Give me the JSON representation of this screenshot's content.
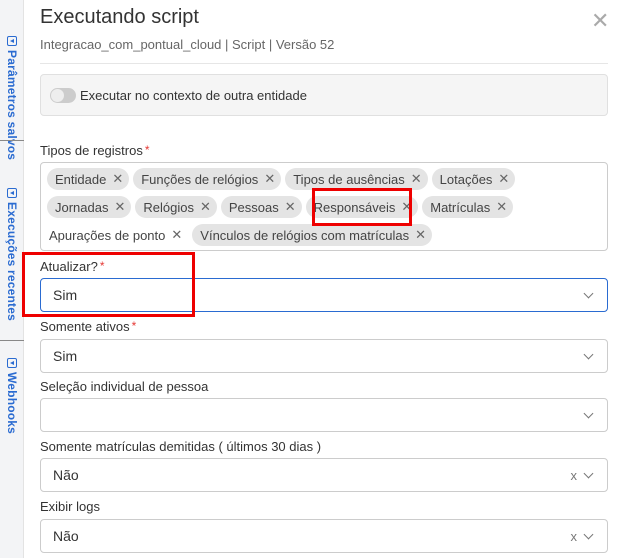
{
  "sidebar": {
    "items": [
      {
        "label": "Parâmetros salvos",
        "icon": "collapse-left-icon"
      },
      {
        "label": "Execuções recentes",
        "icon": "collapse-left-icon"
      },
      {
        "label": "Webhooks",
        "icon": "collapse-left-icon"
      }
    ]
  },
  "header": {
    "title": "Executando script",
    "subtitle": "Integracao_com_pontual_cloud | Script | Versão 52",
    "close": "✕"
  },
  "context_toggle": {
    "label": "Executar no contexto de outra entidade",
    "on": false
  },
  "fields": {
    "tipos": {
      "label": "Tipos de registros",
      "required": "*",
      "chips": [
        "Entidade",
        "Funções de relógios",
        "Tipos de ausências",
        "Lotações",
        "Jornadas",
        "Relógios",
        "Pessoas",
        "Responsáveis",
        "Matrículas",
        "Apurações de ponto",
        "Vínculos de relógios com matrículas"
      ]
    },
    "atualizar": {
      "label": "Atualizar?",
      "required": "*",
      "value": "Sim"
    },
    "somente_ativos": {
      "label": "Somente ativos",
      "required": "*",
      "value": "Sim"
    },
    "selecao_pessoa": {
      "label": "Seleção individual de pessoa",
      "value": ""
    },
    "demitidas": {
      "label": "Somente matrículas demitidas ( últimos 30 dias )",
      "value": "Não",
      "clear": "x"
    },
    "logs": {
      "label": "Exibir logs",
      "value": "Não",
      "clear": "x"
    }
  },
  "colors": {
    "accent": "#2a6bd1",
    "required": "#e53935",
    "highlight": "#e00000"
  }
}
